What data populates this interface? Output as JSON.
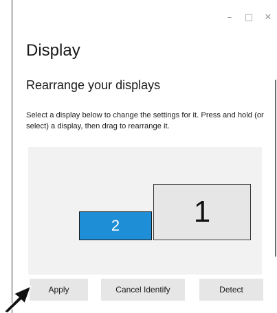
{
  "window": {
    "controls": {
      "minimize": "–",
      "maximize": "□",
      "close": "✕"
    }
  },
  "page": {
    "title": "Display"
  },
  "section": {
    "title": "Rearrange your displays",
    "description": "Select a display below to change the settings for it. Press and hold (or select) a display, then drag to rearrange it."
  },
  "displays": [
    {
      "label": "1",
      "color": "#e6e6e6",
      "selected": false
    },
    {
      "label": "2",
      "color": "#1e8fd6",
      "selected": true
    }
  ],
  "buttons": {
    "apply": "Apply",
    "cancel_identify": "Cancel Identify",
    "detect": "Detect"
  },
  "icons": {
    "cursor": "mouse-pointer-icon"
  }
}
